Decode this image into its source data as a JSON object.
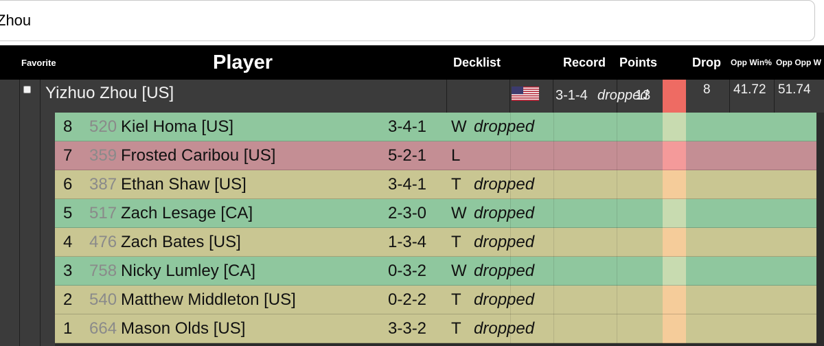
{
  "search": {
    "value": "Zhou"
  },
  "header": {
    "favorite": "Favorite",
    "player": "Player",
    "decklist": "Decklist",
    "record": "Record",
    "points": "Points",
    "drop": "Drop",
    "opp_win": "Opp Win%",
    "opp_opp": "Opp Opp W"
  },
  "player": {
    "name": "Yizhuo Zhou [US]",
    "flag": "us-flag",
    "record": "3-1-4",
    "points": "13",
    "dropped": "dropped",
    "drop": "8",
    "opp_win": "41.72",
    "opp_opp": "51.74"
  },
  "matches": [
    {
      "round": "8",
      "rating": "520",
      "name": "Kiel Homa [US]",
      "record": "3-4-1",
      "result": "W",
      "status": "dropped",
      "outcome": "win"
    },
    {
      "round": "7",
      "rating": "359",
      "name": "Frosted Caribou [US]",
      "record": "5-2-1",
      "result": "L",
      "status": "",
      "outcome": "loss"
    },
    {
      "round": "6",
      "rating": "387",
      "name": "Ethan Shaw [US]",
      "record": "3-4-1",
      "result": "T",
      "status": "dropped",
      "outcome": "tie"
    },
    {
      "round": "5",
      "rating": "517",
      "name": "Zach Lesage [CA]",
      "record": "2-3-0",
      "result": "W",
      "status": "dropped",
      "outcome": "win"
    },
    {
      "round": "4",
      "rating": "476",
      "name": "Zach Bates [US]",
      "record": "1-3-4",
      "result": "T",
      "status": "dropped",
      "outcome": "tie"
    },
    {
      "round": "3",
      "rating": "758",
      "name": "Nicky Lumley [CA]",
      "record": "0-3-2",
      "result": "W",
      "status": "dropped",
      "outcome": "win"
    },
    {
      "round": "2",
      "rating": "540",
      "name": "Matthew Middleton [US]",
      "record": "0-2-2",
      "result": "T",
      "status": "dropped",
      "outcome": "tie"
    },
    {
      "round": "1",
      "rating": "664",
      "name": "Mason Olds [US]",
      "record": "3-3-2",
      "result": "T",
      "status": "dropped",
      "outcome": "tie"
    }
  ],
  "colors": {
    "win": "#8fc79e",
    "loss": "#c48e94",
    "tie": "#c9c692",
    "drop_strip": "#ee6b63"
  }
}
